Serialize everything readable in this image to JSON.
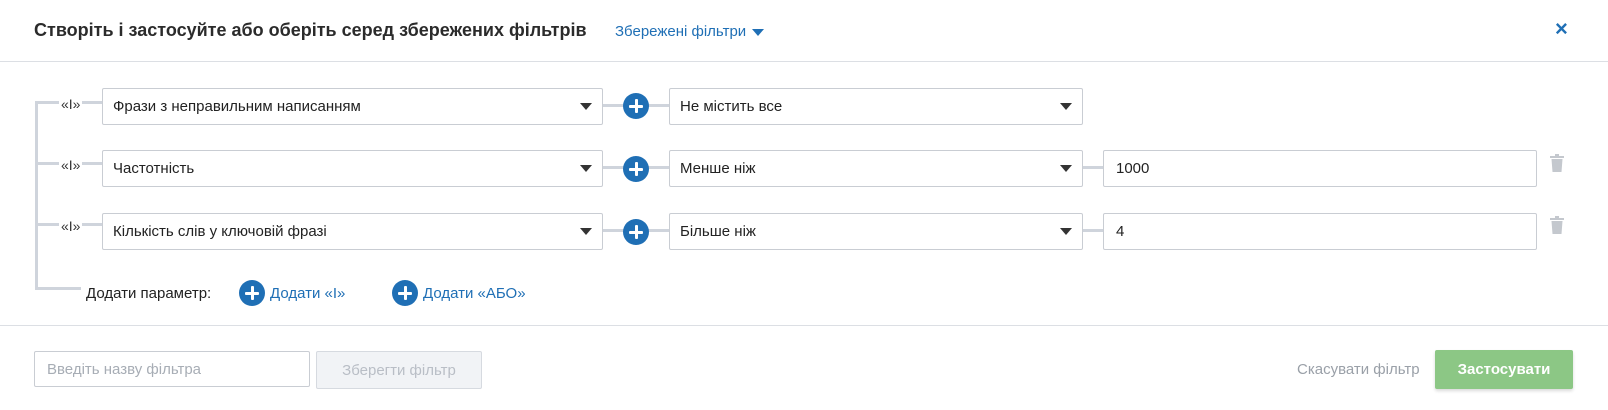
{
  "header": {
    "title": "Створіть і застосуйте або оберіть серед збережених фільтрів",
    "saved_filters_label": "Збережені фільтри",
    "close_symbol": "×"
  },
  "rows": [
    {
      "operator": "«І»",
      "field": "Фрази з неправильним написанням",
      "condition": "Не містить все",
      "value": null,
      "deletable": false
    },
    {
      "operator": "«І»",
      "field": "Частотність",
      "condition": "Менше ніж",
      "value": "1000",
      "deletable": true
    },
    {
      "operator": "«І»",
      "field": "Кількість слів у ключовій фразі",
      "condition": "Більше ніж",
      "value": "4",
      "deletable": true
    }
  ],
  "add_param": {
    "label": "Додати параметр:",
    "add_and": "Додати «І»",
    "add_or": "Додати «АБО»"
  },
  "footer": {
    "filter_name_placeholder": "Введіть назву фільтра",
    "save_button": "Зберегти фільтр",
    "cancel_link": "Скасувати фільтр",
    "apply_button": "Застосувати"
  },
  "colors": {
    "accent": "#1f6fb5",
    "apply_green": "#8cc785",
    "connector_gray": "#cfd4dc"
  }
}
